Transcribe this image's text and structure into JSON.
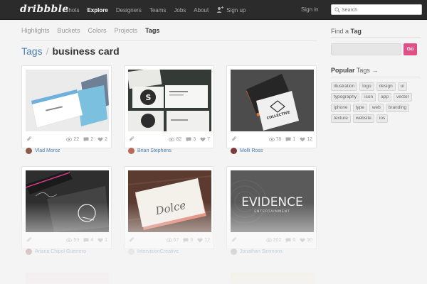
{
  "topbar": {
    "logo": "dribbble",
    "nav": [
      {
        "label": "Shots",
        "active": false
      },
      {
        "label": "Explore",
        "active": true
      },
      {
        "label": "Designers",
        "active": false
      },
      {
        "label": "Teams",
        "active": false
      },
      {
        "label": "Jobs",
        "active": false
      },
      {
        "label": "About",
        "active": false
      }
    ],
    "signup": "Sign up",
    "signin": "Sign in",
    "search_placeholder": "Search"
  },
  "subnav": {
    "items": [
      "Highlights",
      "Buckets",
      "Colors",
      "Projects",
      "Tags"
    ],
    "active": "Tags"
  },
  "heading": {
    "crumb": "Tags",
    "separator": "/",
    "current": "business card"
  },
  "shots": [
    {
      "views": "22",
      "comments": "2",
      "likes": "2",
      "author": "Vlad Moroz"
    },
    {
      "views": "82",
      "comments": "3",
      "likes": "7",
      "author": "Brian Stephens"
    },
    {
      "views": "78",
      "comments": "1",
      "likes": "12",
      "author": "Molli Ross"
    },
    {
      "views": "53",
      "comments": "4",
      "likes": "1",
      "author": "Ariana Chipol Guerrero"
    },
    {
      "views": "67",
      "comments": "3",
      "likes": "12",
      "author": "IntervisionCreative"
    },
    {
      "views": "202",
      "comments": "6",
      "likes": "30",
      "author": "Jonathan Simmons"
    }
  ],
  "shot_art": {
    "evidence_title": "EVIDENCE",
    "evidence_sub": "ENTERTAINMENT",
    "dolce": "Dolce",
    "collective": "COLLECTIVE"
  },
  "sidebar": {
    "find_prefix": "Find a",
    "find_bold": "Tag",
    "go_label": "Go",
    "popular_bold": "Popular",
    "popular_rest": "Tags →",
    "tags": [
      "illustration",
      "logo",
      "design",
      "ui",
      "typography",
      "icon",
      "app",
      "vector",
      "iphone",
      "type",
      "web",
      "branding",
      "texture",
      "website",
      "ios"
    ]
  },
  "colors": {
    "topbar": "#2b2b2b",
    "link": "#4a7fb0",
    "go_button": "#e24f88"
  }
}
